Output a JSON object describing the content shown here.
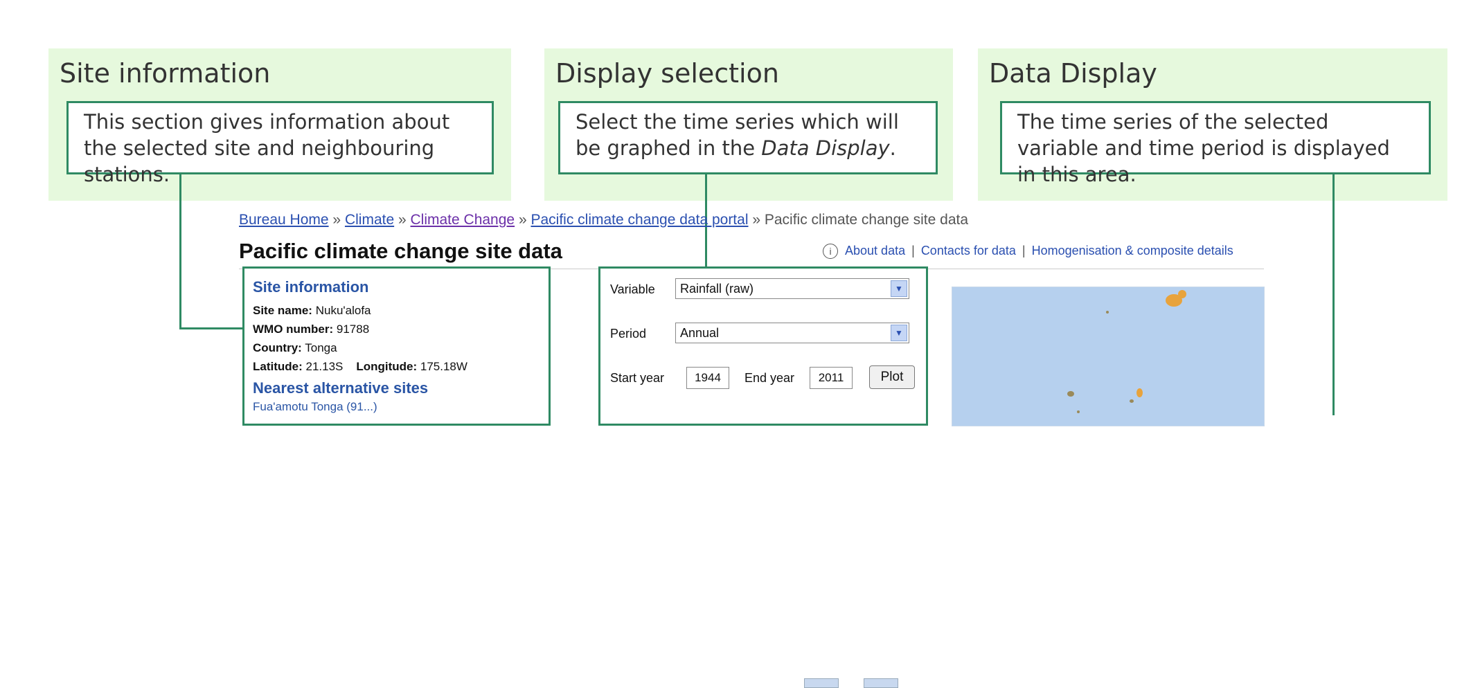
{
  "panels": [
    {
      "title": "Site information",
      "text": "This section gives information about the selected site and neighbouring stations."
    },
    {
      "title": "Display selection",
      "text_before": "Select the time series which will be graphed in the ",
      "text_em": "Data Display",
      "text_after": "."
    },
    {
      "title": "Data Display",
      "text": "The time series of the selected variable and time period is displayed in this area."
    }
  ],
  "breadcrumb": {
    "items": [
      "Bureau Home",
      "Climate",
      "Climate Change",
      "Pacific climate change data portal"
    ],
    "separator": "»",
    "current": "Pacific climate change site data"
  },
  "page_title": "Pacific climate change site data",
  "top_links": [
    "About data",
    "Contacts for data",
    "Homogenisation & composite details"
  ],
  "top_links_separator": "|",
  "info_icon": "info-icon",
  "site_info": {
    "heading": "Site information",
    "fields": [
      {
        "label": "Site name:",
        "value": "Nuku'alofa"
      },
      {
        "label": "WMO number:",
        "value": "91788"
      },
      {
        "label": "Country:",
        "value": "Tonga"
      }
    ],
    "latitude_label": "Latitude:",
    "latitude": "21.13S",
    "longitude_label": "Longitude:",
    "longitude": "175.18W",
    "nearest_heading": "Nearest alternative sites",
    "nearest_partial": "Fua'amotu Tonga (91...)"
  },
  "display_selection": {
    "variable_label": "Variable",
    "variable_value": "Rainfall (raw)",
    "period_label": "Period",
    "period_value": "Annual",
    "start_label": "Start year",
    "start_value": "1944",
    "end_label": "End year",
    "end_value": "2011",
    "plot_label": "Plot"
  },
  "colors": {
    "panel_bg": "#e6f9dd",
    "callout_border": "#2f8a63",
    "link": "#2a4fb0",
    "map_sea": "#b6d0ee"
  }
}
